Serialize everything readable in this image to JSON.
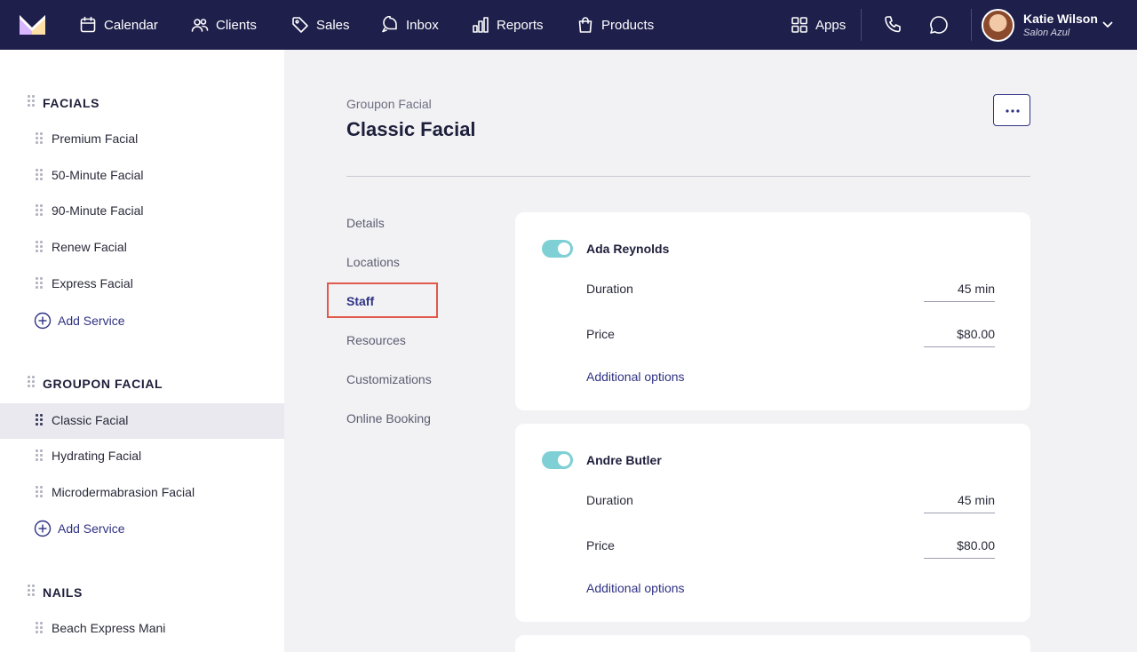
{
  "nav": {
    "items": [
      {
        "label": "Calendar",
        "icon": "calendar-icon"
      },
      {
        "label": "Clients",
        "icon": "clients-icon"
      },
      {
        "label": "Sales",
        "icon": "tag-icon"
      },
      {
        "label": "Inbox",
        "icon": "inbox-icon"
      },
      {
        "label": "Reports",
        "icon": "bar-chart-icon"
      },
      {
        "label": "Products",
        "icon": "shopping-bag-icon"
      }
    ],
    "apps_label": "Apps",
    "user": {
      "name": "Katie Wilson",
      "location": "Salon Azul"
    }
  },
  "sidebar": {
    "categories": [
      {
        "title": "FACIALS",
        "services": [
          "Premium Facial",
          "50-Minute Facial",
          "90-Minute Facial",
          "Renew Facial",
          "Express Facial"
        ],
        "add_label": "Add Service"
      },
      {
        "title": "GROUPON FACIAL",
        "services": [
          "Classic Facial",
          "Hydrating Facial",
          "Microdermabrasion Facial"
        ],
        "add_label": "Add Service",
        "active_service": "Classic Facial"
      },
      {
        "title": "NAILS",
        "services": [
          "Beach Express Mani"
        ]
      }
    ]
  },
  "main": {
    "breadcrumb": "Groupon Facial",
    "title": "Classic Facial",
    "tabs": [
      "Details",
      "Locations",
      "Staff",
      "Resources",
      "Customizations",
      "Online Booking"
    ],
    "active_tab": "Staff",
    "staff": [
      {
        "name": "Ada Reynolds",
        "enabled": true,
        "duration_label": "Duration",
        "duration": "45 min",
        "price_label": "Price",
        "price": "$80.00",
        "options_label": "Additional options"
      },
      {
        "name": "Andre Butler",
        "enabled": true,
        "duration_label": "Duration",
        "duration": "45 min",
        "price_label": "Price",
        "price": "$80.00",
        "options_label": "Additional options"
      }
    ]
  },
  "colors": {
    "nav_bg": "#1e1f4b",
    "accent": "#2f3283",
    "toggle_on": "#7fd0d4",
    "highlight": "#e0594a"
  }
}
